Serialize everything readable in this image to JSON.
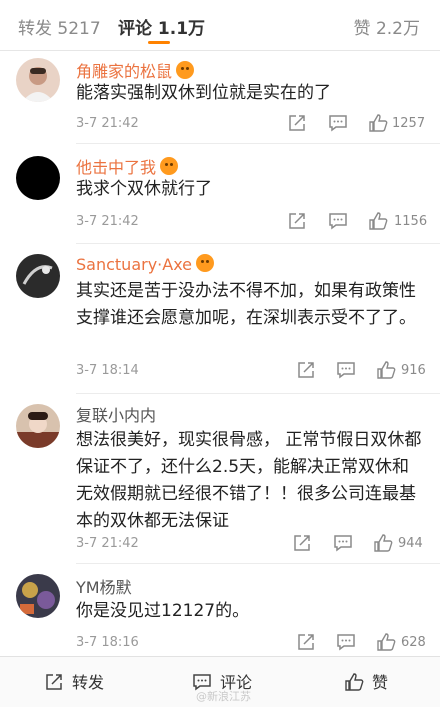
{
  "tabs": {
    "repost": "转发 5217",
    "comments": "评论 1.1万",
    "likes": "赞 2.2万"
  },
  "comments": [
    {
      "user": "角雕家的松鼠",
      "text": "能落实强制双休到位就是实在的了",
      "time": "3-7 21:42",
      "likes": "1257"
    },
    {
      "user": "他击中了我",
      "text": "我求个双休就行了",
      "time": "3-7 21:42",
      "likes": "1156"
    },
    {
      "user": "Sanctuary·Axe",
      "text": "其实还是苦于没办法不得不加，如果有政策性支撑谁还会愿意加呢，在深圳表示受不了了。",
      "time": "3-7 18:14",
      "likes": "916"
    },
    {
      "user": "复联小内内",
      "text": "想法很美好，现实很骨感， 正常节假日双休都保证不了，还什么2.5天，能解决正常双休和无效假期就已经很不错了！！很多公司连最基本的双休都无法保证",
      "time": "3-7 21:42",
      "likes": "944"
    },
    {
      "user": "YM杨默",
      "text": "你是没见过12127的。",
      "time": "3-7 18:16",
      "likes": "628"
    }
  ],
  "bottom": {
    "repost": "转发",
    "comment": "评论",
    "like": "赞"
  },
  "watermark": "@新浪江苏",
  "colors": {
    "accent": "#ff8200",
    "username": "#eb7340"
  }
}
